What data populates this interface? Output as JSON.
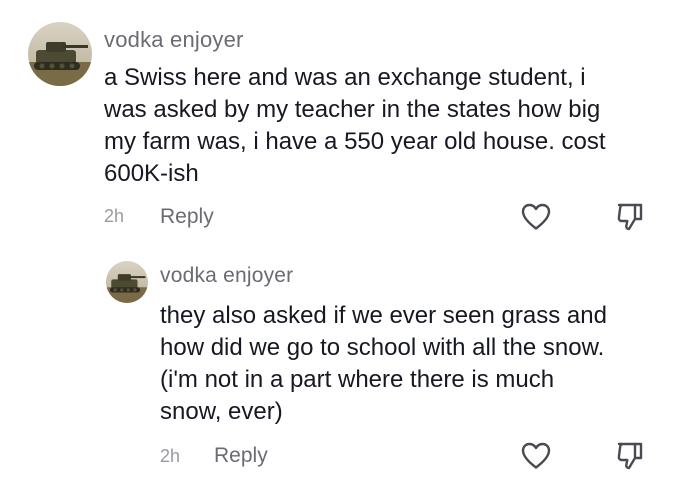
{
  "comments": [
    {
      "username": "vodka enjoyer",
      "text": "a Swiss here and was an exchange student, i\nwas asked by my teacher in the states how big\nmy farm was, i have a 550 year old house. cost\n600K-ish",
      "time": "2h",
      "reply_label": "Reply",
      "avatar_icon": "tank-photo-avatar",
      "like_icon": "heart-outline-icon",
      "dislike_icon": "thumbs-down-icon"
    }
  ],
  "replies": [
    {
      "username": "vodka enjoyer",
      "text": "they also asked if we ever seen grass and\nhow did we go to school with all the snow.\n(i'm not in a part where there is much\nsnow, ever)",
      "time": "2h",
      "reply_label": "Reply",
      "avatar_icon": "tank-photo-avatar",
      "like_icon": "heart-outline-icon",
      "dislike_icon": "thumbs-down-icon"
    }
  ],
  "colors": {
    "text": "#161823",
    "username": "#6b6b73",
    "timestamp": "#9a9aa0",
    "icon_stroke": "#4a4a52"
  }
}
